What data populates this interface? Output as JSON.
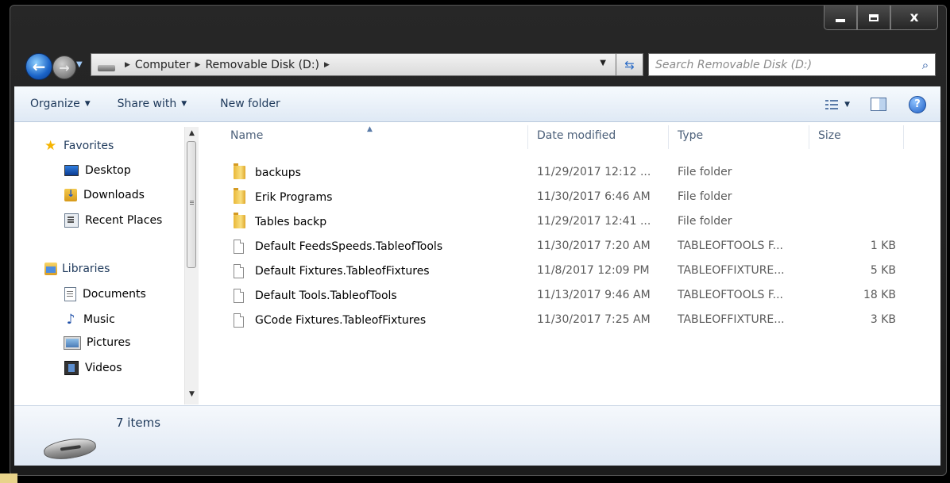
{
  "window": {
    "caption": {
      "minimize": "",
      "maximize": "",
      "close": "x"
    }
  },
  "nav": {
    "breadcrumbs": [
      "Computer",
      "Removable Disk (D:)"
    ],
    "search_placeholder": "Search Removable Disk (D:)"
  },
  "toolbar": {
    "organize": "Organize",
    "share_with": "Share with",
    "new_folder": "New folder"
  },
  "sidebar": {
    "favorites": {
      "label": "Favorites",
      "items": [
        {
          "label": "Desktop",
          "icon": "desktop-icon"
        },
        {
          "label": "Downloads",
          "icon": "downloads-icon"
        },
        {
          "label": "Recent Places",
          "icon": "recent-places-icon"
        }
      ]
    },
    "libraries": {
      "label": "Libraries",
      "items": [
        {
          "label": "Documents",
          "icon": "documents-icon"
        },
        {
          "label": "Music",
          "icon": "music-icon"
        },
        {
          "label": "Pictures",
          "icon": "pictures-icon"
        },
        {
          "label": "Videos",
          "icon": "videos-icon"
        }
      ]
    }
  },
  "files": {
    "columns": {
      "name": "Name",
      "date": "Date modified",
      "type": "Type",
      "size": "Size"
    },
    "rows": [
      {
        "name": "backups",
        "date": "11/29/2017 12:12 ...",
        "type": "File folder",
        "size": "",
        "kind": "folder"
      },
      {
        "name": "Erik Programs",
        "date": "11/30/2017 6:46 AM",
        "type": "File folder",
        "size": "",
        "kind": "folder"
      },
      {
        "name": "Tables backp",
        "date": "11/29/2017 12:41 ...",
        "type": "File folder",
        "size": "",
        "kind": "folder"
      },
      {
        "name": "Default FeedsSpeeds.TableofTools",
        "date": "11/30/2017 7:20 AM",
        "type": "TABLEOFTOOLS F...",
        "size": "1 KB",
        "kind": "file"
      },
      {
        "name": "Default Fixtures.TableofFixtures",
        "date": "11/8/2017 12:09 PM",
        "type": "TABLEOFFIXTURE...",
        "size": "5 KB",
        "kind": "file"
      },
      {
        "name": "Default Tools.TableofTools",
        "date": "11/13/2017 9:46 AM",
        "type": "TABLEOFTOOLS F...",
        "size": "18 KB",
        "kind": "file"
      },
      {
        "name": "GCode Fixtures.TableofFixtures",
        "date": "11/30/2017 7:25 AM",
        "type": "TABLEOFFIXTURE...",
        "size": "3 KB",
        "kind": "file"
      }
    ]
  },
  "details": {
    "item_count": "7 items"
  },
  "colors": {
    "accent": "#1e395b",
    "toolbar_bg": "#dfe9f5",
    "folder": "#e9b737"
  }
}
